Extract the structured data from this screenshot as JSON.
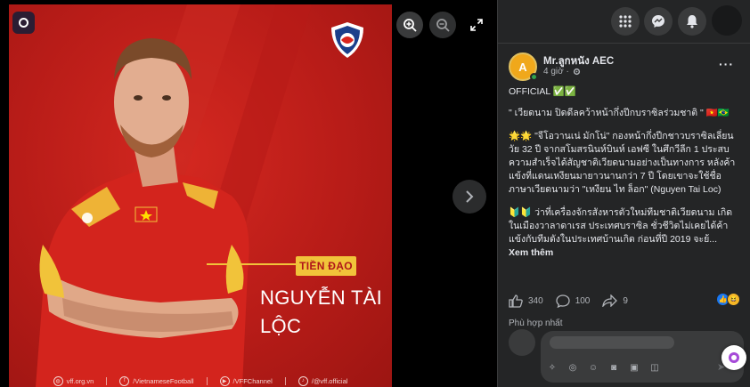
{
  "viewer": {
    "photo": {
      "position_label": "TIỀN ĐẠO",
      "player_name_line1": "NGUYỄN TÀI",
      "player_name_line2": "LỘC",
      "crest_text": "VFF",
      "footer": [
        {
          "icon": "globe-icon",
          "text": "vff.org.vn"
        },
        {
          "icon": "facebook-icon",
          "text": "/VietnameseFootball"
        },
        {
          "icon": "youtube-icon",
          "text": "/VFFChannel"
        },
        {
          "icon": "tiktok-icon",
          "text": "/@vff.official"
        }
      ]
    },
    "buttons": [
      "zoom-in-icon",
      "zoom-out-icon",
      "fullscreen-icon",
      "chevron-right-icon"
    ]
  },
  "topbar": {
    "icons": [
      "apps-grid-icon",
      "messenger-icon",
      "bell-icon"
    ]
  },
  "post": {
    "author": "Mr.ลูกหนัง AEC",
    "author_initial": "A",
    "time": "4 giờ ·",
    "paragraphs": [
      "OFFICIAL ✅✅",
      "\" เวียดนาม ปิดดีลคว้าหน้ากึ่งปีกบราซิลร่วมชาติ \" 🇻🇳🇧🇷",
      "🌟🌟 \"จีโอวานเน่ มักโน่\" กองหน้ากึ่งปีกชาวบราซิลเลี่ยนวัย 32 ปี จากสโมสรนินห์บินห์ เอฟซี ในศึกวีลีก 1 ประสบความสำเร็จได้สัญชาติเวียดนามอย่างเป็นทางการ หลังค้าแข้งที่แดนเหงียนมายาวนานกว่า 7 ปี โดยเขาจะใช้ชื่อภาษาเวียดนามว่า \"เหงียน ไท ล็อก\" (Nguyen Tai Loc)",
      "🔰🔰 ว่าที่เครื่องจักรสังหารตัวใหม่ทีมชาติเวียดนาม เกิดในเมืองวาลาดาเรส ประเทศบราซิล ชั่วชีวิตไม่เคยได้ค้าแข้งกับทีมดังในประเทศบ้านเกิด ก่อนที่ปี 2019 จะย้..."
    ],
    "see_more": "Xem thêm",
    "likes": "340",
    "comments": "100",
    "shares": "9",
    "comment_stub": "Phù hợp nhất"
  },
  "colors": {
    "facebook_blue": "#1877f2",
    "panel_bg": "#242526",
    "photo_red": "#c4221c",
    "badge_yellow": "#f1c33a"
  }
}
